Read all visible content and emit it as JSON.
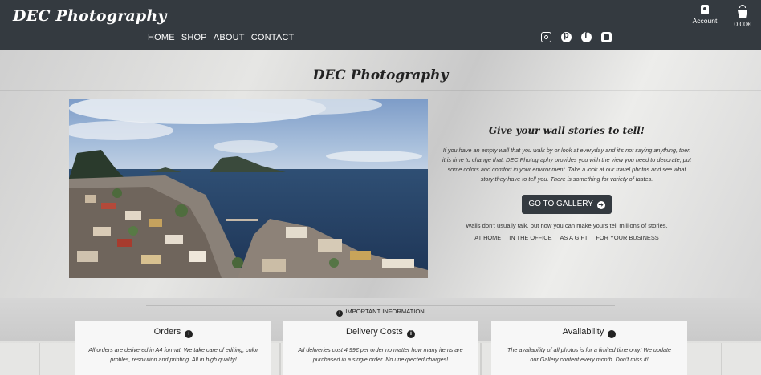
{
  "header": {
    "brand": "DEC Photography",
    "nav": [
      "HOME",
      "SHOP",
      "ABOUT",
      "CONTACT"
    ],
    "social_icons": [
      "instagram-icon",
      "pinterest-icon",
      "facebook-icon",
      "youtube-icon"
    ],
    "account_label": "Account",
    "bag_total": "0.00€"
  },
  "hero": {
    "title": "DEC Photography",
    "tagline": "Give your wall stories to tell!",
    "description": "If you have an empty wall that you walk by or look at everyday and it's not saying anything, then it is time to change that. DEC Photography provides you with the view you need to decorate, put some colors and comfort in your environment. Take a look at our travel photos and see what story they have to tell you. There is something for variety of tastes.",
    "gallery_button": "GO TO GALLERY",
    "walls_text": "Walls don't usually talk, but now you can make yours tell millions of stories.",
    "links": [
      "AT HOME",
      "IN THE OFFICE",
      "AS A GIFT",
      "FOR YOUR BUSINESS"
    ]
  },
  "info": {
    "heading": "IMPORTANT INFORMATION",
    "cards": [
      {
        "title": "Orders",
        "text": "All orders are delivered in A4 format. We take care of editing, color profiles, resolution and printing. All in high quality!"
      },
      {
        "title": "Delivery Costs",
        "text": "All deliveries cost 4.99€ per order no matter how many items are purchased in a single order. No unexpected charges!"
      },
      {
        "title": "Availability",
        "text": "The availability of all photos is for a limited time only! We update our Gallery content every month. Don't miss it!"
      }
    ]
  },
  "colors": {
    "header_bg": "#343a40",
    "button_bg": "#343a40"
  }
}
